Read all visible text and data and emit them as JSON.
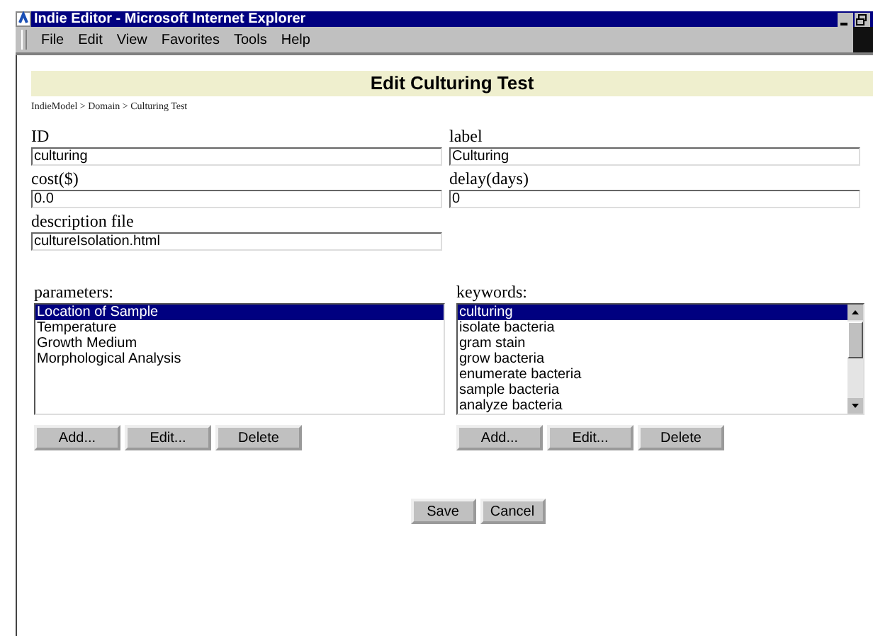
{
  "window": {
    "title": "Indie Editor - Microsoft Internet Explorer"
  },
  "menu": [
    "File",
    "Edit",
    "View",
    "Favorites",
    "Tools",
    "Help"
  ],
  "page": {
    "heading": "Edit Culturing Test",
    "breadcrumb": "IndieModel > Domain > Culturing Test"
  },
  "fields": [
    {
      "label": "ID",
      "value": "culturing"
    },
    {
      "label": "label",
      "value": "Culturing"
    },
    {
      "label": "cost($)",
      "value": "0.0"
    },
    {
      "label": "delay(days)",
      "value": "0"
    },
    {
      "label": "description file",
      "value": "cultureIsolation.html"
    }
  ],
  "lists": [
    {
      "label": "parameters:",
      "scrollbar": false,
      "items": [
        {
          "text": "Location of Sample",
          "selected": true
        },
        {
          "text": "Temperature",
          "selected": false
        },
        {
          "text": "Growth Medium",
          "selected": false
        },
        {
          "text": "Morphological Analysis",
          "selected": false
        }
      ],
      "buttons": [
        "Add...",
        "Edit...",
        "Delete"
      ]
    },
    {
      "label": "keywords:",
      "scrollbar": true,
      "items": [
        {
          "text": "culturing",
          "selected": true
        },
        {
          "text": "isolate bacteria",
          "selected": false
        },
        {
          "text": "gram stain",
          "selected": false
        },
        {
          "text": "grow bacteria",
          "selected": false
        },
        {
          "text": "enumerate bacteria",
          "selected": false
        },
        {
          "text": "sample bacteria",
          "selected": false
        },
        {
          "text": "analyze bacteria",
          "selected": false
        }
      ],
      "buttons": [
        "Add...",
        "Edit...",
        "Delete"
      ]
    }
  ],
  "actions": [
    "Save",
    "Cancel"
  ]
}
